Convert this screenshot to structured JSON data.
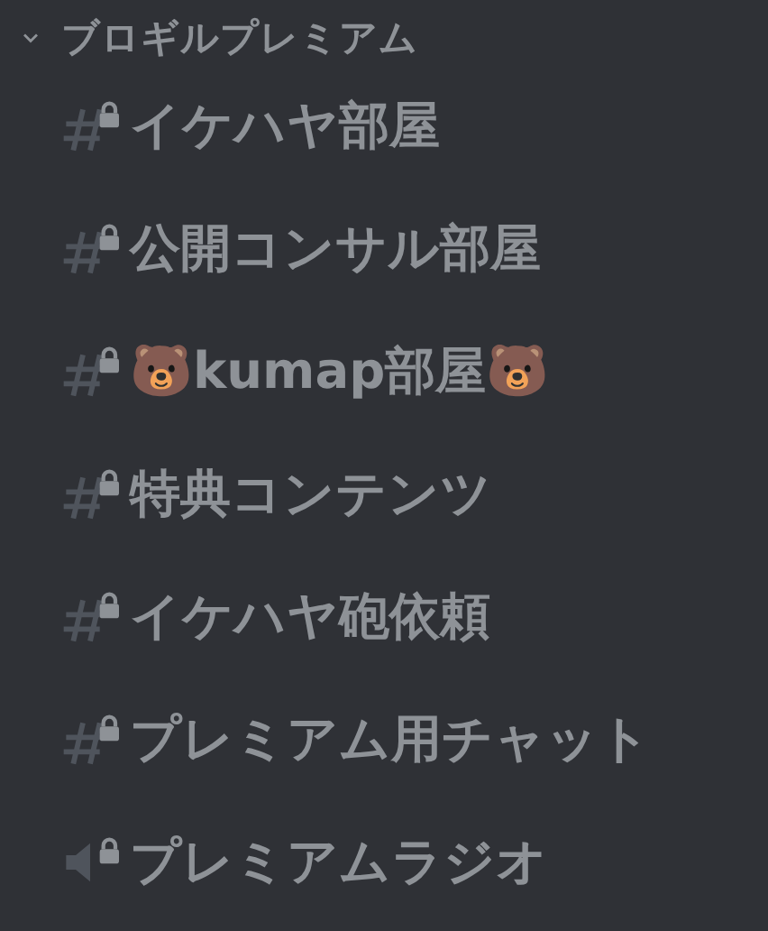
{
  "category": {
    "name": "ブロギルプレミアム",
    "expanded": true
  },
  "channels": [
    {
      "kind": "text",
      "name": "イケハヤ部屋",
      "locked": true
    },
    {
      "kind": "text",
      "name": "公開コンサル部屋",
      "locked": true
    },
    {
      "kind": "text",
      "name": "🐻kumap部屋🐻",
      "locked": true
    },
    {
      "kind": "text",
      "name": "特典コンテンツ",
      "locked": true
    },
    {
      "kind": "text",
      "name": "イケハヤ砲依頼",
      "locked": true
    },
    {
      "kind": "text",
      "name": "プレミアム用チャット",
      "locked": true
    },
    {
      "kind": "voice",
      "name": "プレミアムラジオ",
      "locked": true
    }
  ]
}
